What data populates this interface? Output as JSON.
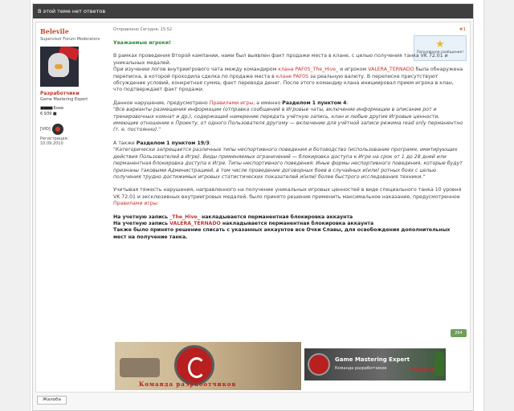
{
  "topbar": {
    "text": "В этой теме нет ответов"
  },
  "user": {
    "name": "Belevile",
    "role": "Supervisor Forum Moderators",
    "group": "Разработчики",
    "group_sub": "Game Mastering Expert",
    "posts_label": "Боев",
    "posts_value": "6 939",
    "clan": "[VIO]",
    "reg_label": "Регистрация:",
    "reg_date": "10.09.2010"
  },
  "post": {
    "meta": "Отправлено Сегодня, 15:52",
    "number": "#1",
    "best": "Популярное сообщение!",
    "greeting": "Уважаемые игроки!",
    "p1": "В рамках проведения Второй кампании, нами был выявлен факт продажи места в клане, с целью получения танка VK 72.01 и уникальных медалей.",
    "p2_a": "При изучении логов внутриигрового чата между командиром ",
    "p2_b": "клана PAF0S_The_Hive_",
    "p2_c": " и игроком ",
    "p2_d": "VALERA_TERNADO",
    "p2_e": " была обнаружена переписка, в которой проходила сделка по продаже места в ",
    "p2_f": "клане PAF0S",
    "p2_g": " за реальную валюту. В переписке присутствуют обсуждение условий, конкретная сумма, факт перевода денег. После этого командир клана инициировал прием игрока в клан, что подтверждает факт продажи.",
    "p3_a": "Данное нарушение, предусмотрено ",
    "p3_b": "Правилами игры",
    "p3_c": ", а именно ",
    "p3_d": "Разделом 1 пунктом 4",
    "p3_e": ":",
    "quote1": "\"Все варианты размещения информации (отправка сообщений в Игровые чаты, включение информации в описание рот и тренировочных комнат и др.), содержащей намерение передать учётную запись, клан и любые другие Игровые ценности, имеющие отношение к Проекту, от одного Пользователя другому — включение для учётной записи режима read only перманентно (т. е. постоянно).\"",
    "p4_a": "А также ",
    "p4_b": "Разделом 1 пунктом 19/3",
    "p4_c": ":",
    "quote2": "\"Категорически запрещается различные типы неспортивного поведения и ботоводство (использование программ, имитирующих действия Пользователей в Игре). Виды применяемых ограничений — блокировка доступа к Игре на срок от 1 до 28 дней или перманентная блокировка доступа к Игре. Типы неспортивного поведения: Иные формы неспортивного поведения, которые будут признаны таковыми Администрацией, в том числе проведение договорных боев в случайных и(или) ротных боях с целью получения трудно достижимых игровых статистических показателей и(или) более быстрого исследования техники.\"",
    "p5_a": "Учитывая тяжесть нарушения, направленного на получение уникальных игровых ценностей в виде специального танка 10 уровня VK 72.01 и эксклюзивных внутриигровых медалей, было принято решение применить максимальное наказание, предусмотренное ",
    "p5_b": "Правилами игры",
    "p5_c": ":",
    "s1_a": "На учетную запись ",
    "s1_b": "_The_Hive_",
    "s1_c": " накладывается перманентная блокировка аккаунта",
    "s2_a": "На учетную запись ",
    "s2_b": "VALERA_TERNADO",
    "s2_c": " накладывается перманентная блокировка аккаунта",
    "s3": "Также было принято решение списать с указанных аккаунтов все Очки Славы, для освобождения дополнительных мест на получение танка.",
    "counter": "264"
  },
  "banner1": {
    "text": "Команда разработчиков"
  },
  "banner2": {
    "title": "Game Mastering Expert",
    "sub": "Команда разработчиков",
    "tag": "WORLD OF"
  },
  "buttons": {
    "complain": "Жалоба"
  },
  "colors": {
    "accent": "#c04a2a",
    "green": "#2f8a36",
    "rule_link": "#c23535",
    "topbar": "#3f3f3f"
  }
}
